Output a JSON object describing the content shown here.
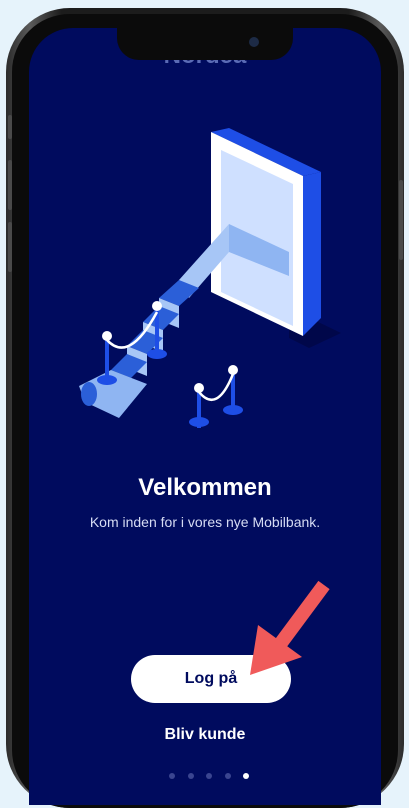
{
  "app": {
    "partial_logo": "Nordea"
  },
  "welcome": {
    "title": "Velkommen",
    "subtitle": "Kom inden for i vores nye Mobilbank."
  },
  "actions": {
    "login_label": "Log på",
    "signup_label": "Bliv kunde"
  },
  "pager": {
    "count": 5,
    "active_index": 4
  },
  "colors": {
    "background": "#000b5e",
    "button": "#ffffff",
    "arrow": "#f05a5a",
    "illustration_blue": "#1e4ee6"
  }
}
